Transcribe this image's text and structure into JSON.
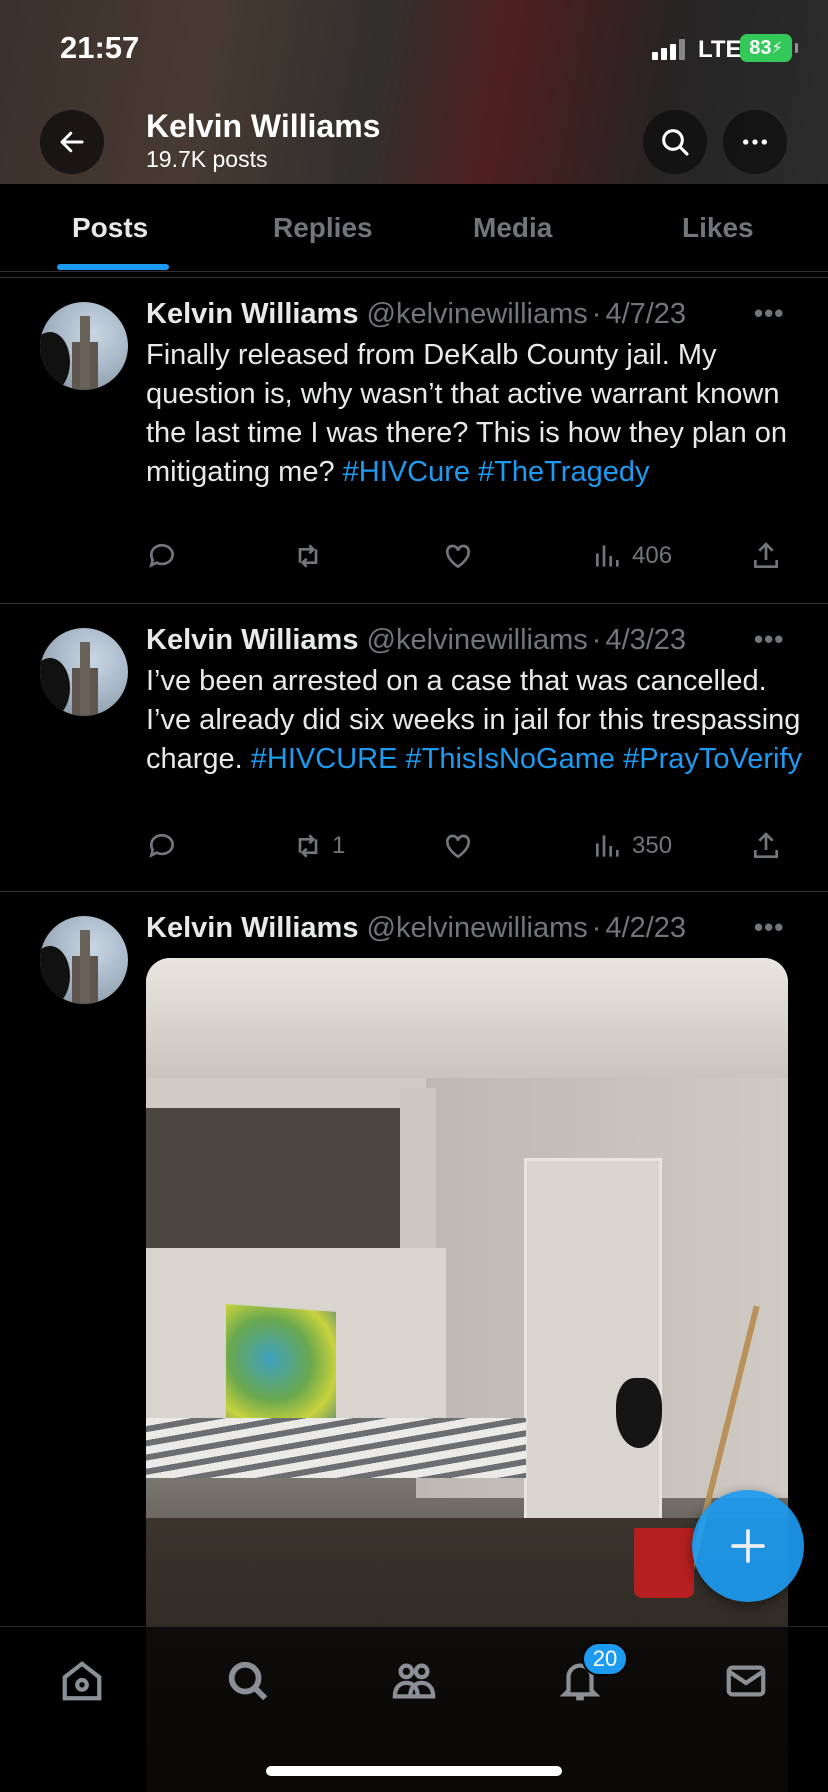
{
  "status_bar": {
    "time": "21:57",
    "network": "LTE",
    "battery": "83"
  },
  "profile": {
    "name": "Kelvin Williams",
    "posts_count": "19.7K posts"
  },
  "tabs": [
    {
      "label": "Posts",
      "active": true
    },
    {
      "label": "Replies",
      "active": false
    },
    {
      "label": "Media",
      "active": false
    },
    {
      "label": "Likes",
      "active": false
    }
  ],
  "tweets": [
    {
      "author": "Kelvin Williams",
      "handle": "@kelvinewilliams",
      "date": "4/7/23",
      "text": "Finally released from DeKalb County jail. My question is, why wasn’t that active warrant known the last time I was there? This is how they plan on mitigating me?",
      "hashtags": [
        "#HIVCure",
        "#TheTragedy"
      ],
      "retweets": "",
      "views": "406"
    },
    {
      "author": "Kelvin Williams",
      "handle": "@kelvinewilliams",
      "date": "4/3/23",
      "text": "I’ve been arrested on a case that was cancelled. I’ve already did six weeks in jail for this trespassing charge.",
      "hashtags": [
        "#HIVCURE",
        "#ThisIsNoGame",
        "#PrayToVerify"
      ],
      "retweets": "1",
      "views": "350"
    },
    {
      "author": "Kelvin Williams",
      "handle": "@kelvinewilliams",
      "date": "4/2/23"
    }
  ],
  "bottom_nav": {
    "items": [
      "home-icon",
      "search-icon",
      "communities-icon",
      "notifications-icon",
      "messages-icon"
    ],
    "notification_badge": "20"
  },
  "colors": {
    "accent": "#1d9bf0",
    "background": "#000000",
    "muted": "#71767b"
  }
}
